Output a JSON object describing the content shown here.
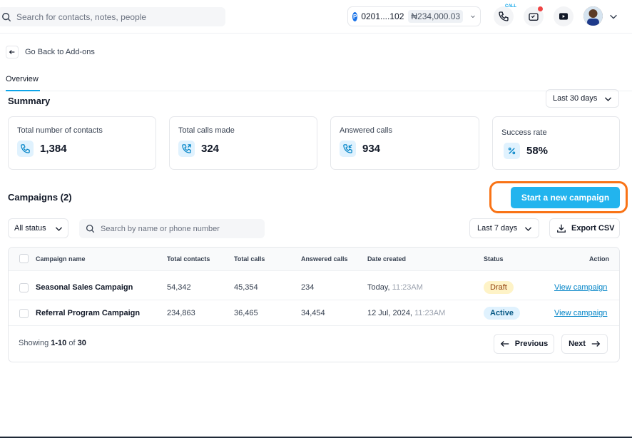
{
  "topbar": {
    "search_placeholder": "Search for contacts, notes, people",
    "account_number": "0201....102",
    "account_balance": "₦234,000.03",
    "account_logo": "P",
    "call_label": "CALL"
  },
  "nav": {
    "back_label": "Go Back to Add-ons",
    "tab_overview": "Overview"
  },
  "summary": {
    "title": "Summary",
    "range": "Last 30 days",
    "cards": [
      {
        "label": "Total number of contacts",
        "value": "1,384",
        "icon": "phone-icon"
      },
      {
        "label": "Total calls made",
        "value": "324",
        "icon": "phone-outgoing-icon"
      },
      {
        "label": "Answered calls",
        "value": "934",
        "icon": "phone-incoming-icon"
      },
      {
        "label": "Success rate",
        "value": "58%",
        "icon": "percent-icon"
      }
    ]
  },
  "campaigns": {
    "title": "Campaigns (2)",
    "new_button": "Start a new campaign",
    "status_filter": "All status",
    "search_placeholder": "Search by name or phone number",
    "date_filter": "Last 7 days",
    "export": "Export CSV",
    "columns": [
      "Campaign name",
      "Total contacts",
      "Total calls",
      "Answered calls",
      "Date created",
      "Status",
      "Action"
    ],
    "rows": [
      {
        "name": "Seasonal Sales Campaign",
        "contacts": "54,342",
        "calls": "45,354",
        "answered": "234",
        "date": "Today,",
        "time": "11:23AM",
        "status": "Draft",
        "action": "View campaign"
      },
      {
        "name": "Referral Program Campaign",
        "contacts": "234,863",
        "calls": "36,465",
        "answered": "34,454",
        "date": "12 Jul, 2024,",
        "time": "11:23AM",
        "status": "Active",
        "action": "View campaign"
      }
    ],
    "showing_prefix": "Showing",
    "showing_range": "1-10",
    "showing_of": "of",
    "showing_total": "30",
    "previous": "Previous",
    "next": "Next"
  },
  "colors": {
    "accent": "#22b4ee",
    "highlight": "#f97316",
    "draft_bg": "#fef3c7",
    "active_bg": "#e0f2fe"
  }
}
